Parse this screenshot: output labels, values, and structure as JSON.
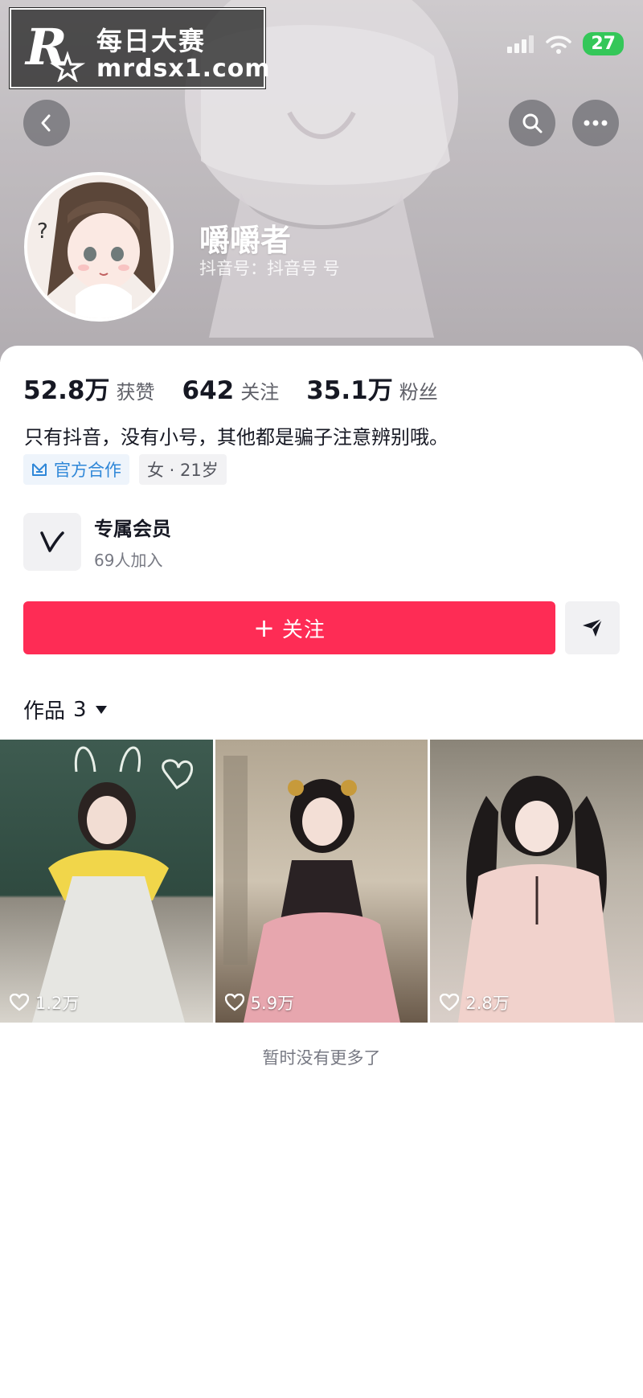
{
  "watermark": {
    "title": "每日大赛",
    "url": "mrdsx1.com"
  },
  "status_bar": {
    "battery": "27"
  },
  "header": {
    "back_icon": "chevron-left-icon",
    "search_icon": "search-icon",
    "more_icon": "more-horizontal-icon"
  },
  "profile": {
    "nickname": "嚼嚼者",
    "douyin_id": "抖音号：抖音号 号",
    "stats": [
      {
        "value": "52.8万",
        "label": "获赞"
      },
      {
        "value": "642",
        "label": "关注"
      },
      {
        "value": "35.1万",
        "label": "粉丝"
      }
    ],
    "bio": "只有抖音，没有小号，其他都是骗子注意辨别哦。",
    "tags": [
      {
        "label": "官方合作",
        "icon": "official-cooperation-icon"
      },
      {
        "label": "女 · 21岁"
      }
    ]
  },
  "membership": {
    "title": "专属会员",
    "subtitle": "69人加入",
    "icon": "v-member-icon"
  },
  "actions": {
    "follow_label": "关注",
    "follow_prefix": "+",
    "message_icon": "send-icon"
  },
  "works": {
    "label": "作品",
    "count": "3",
    "items": [
      {
        "likes": "1.2万"
      },
      {
        "likes": "5.9万"
      },
      {
        "likes": "2.8万"
      }
    ]
  },
  "footer": {
    "no_more": "暂时没有更多了"
  },
  "colors": {
    "accent": "#fe2c55",
    "official": "#2f87d8",
    "battery": "#34c759"
  }
}
